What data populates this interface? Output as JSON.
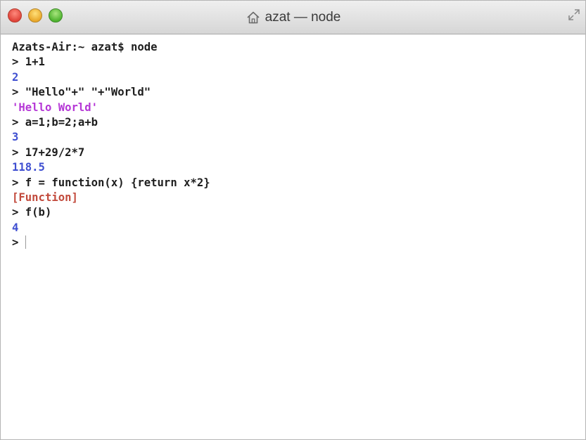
{
  "window": {
    "title": "azat — node",
    "title_icon": "home-icon",
    "fullscreen_icon": "fullscreen-icon"
  },
  "colors": {
    "prompt_text": "#1e1e1e",
    "number": "#3f4fd1",
    "string": "#b537d6",
    "special": "#c24a3c"
  },
  "terminal": {
    "prompt_line": "Azats-Air:~ azat$ node",
    "lines": [
      {
        "text": "> 1+1",
        "kind": "input"
      },
      {
        "text": "2",
        "kind": "number"
      },
      {
        "text": "> \"Hello\"+\" \"+\"World\"",
        "kind": "input"
      },
      {
        "text": "'Hello World'",
        "kind": "string"
      },
      {
        "text": "> a=1;b=2;a+b",
        "kind": "input"
      },
      {
        "text": "3",
        "kind": "number"
      },
      {
        "text": "> 17+29/2*7",
        "kind": "input"
      },
      {
        "text": "118.5",
        "kind": "number"
      },
      {
        "text": "> f = function(x) {return x*2}",
        "kind": "input"
      },
      {
        "text": "[Function]",
        "kind": "special"
      },
      {
        "text": "> f(b)",
        "kind": "input"
      },
      {
        "text": "4",
        "kind": "number"
      }
    ],
    "current_prompt": "> "
  }
}
